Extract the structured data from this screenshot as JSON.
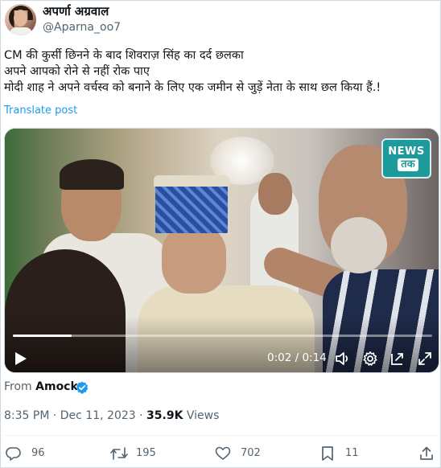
{
  "author": {
    "display_name": "अपर्णा अग्रवाल",
    "handle": "@Aparna_oo7"
  },
  "tweet": {
    "lines": [
      "CM की कुर्सी छिनने के बाद शिवराज़ सिंह का दर्द छलका",
      "अपने आपको रोने से नहीं रोक पाए",
      "मोदी शाह ने अपने वर्चस्व को बनाने के लिए एक जमीन से जुड़ें नेता के साथ छल किया हैं.!"
    ],
    "translate_label": "Translate post"
  },
  "video": {
    "logo_top": "NEWS",
    "logo_bottom": "तक",
    "time": "0:02 / 0:14",
    "progress": 0.14
  },
  "source": {
    "from_label": "From",
    "account": "Amock"
  },
  "meta": {
    "time": "8:35 PM",
    "separator": "·",
    "date": "Dec 11, 2023",
    "views_count": "35.9K",
    "views_label": "Views"
  },
  "actions": {
    "replies": "96",
    "reposts": "195",
    "likes": "702",
    "bookmarks": "11"
  },
  "colors": {
    "accent": "#1d9bf0",
    "text": "#0f1419",
    "muted": "#536471"
  }
}
